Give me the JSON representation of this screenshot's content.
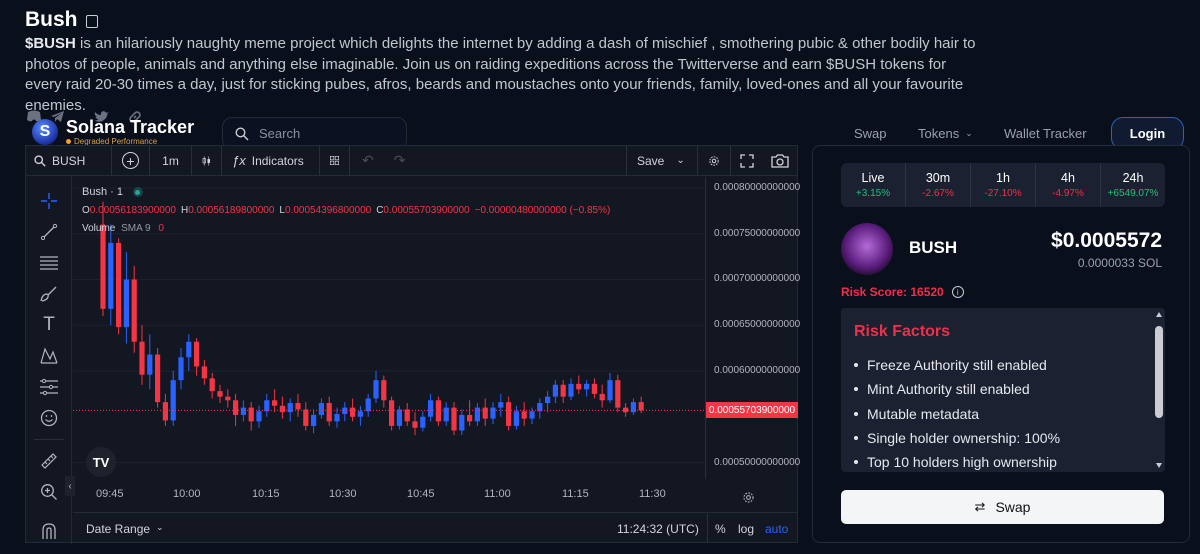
{
  "project": {
    "title": "Bush",
    "desc_ticker": "$BUSH",
    "description": " is an hilariously naughty meme project which delights the internet by adding a dash of mischief , smothering pubic & other bodily hair to photos of people, animals and anything else imaginable. Join us on raiding expeditions across the Twitterverse and earn $BUSH tokens for every raid 20-30 times a day, just for sticking pubes, afros, beards and moustaches onto your friends, family, loved-ones and all your favourite enemies."
  },
  "header": {
    "brand": "Solana Tracker",
    "brand_status": "Degraded Performance",
    "search_placeholder": "Search",
    "nav": [
      "Swap",
      "Tokens",
      "Wallet Tracker"
    ],
    "login": "Login"
  },
  "chart_toolbar": {
    "symbol": "BUSH",
    "interval": "1m",
    "indicators": "Indicators",
    "save": "Save"
  },
  "chart_legend": {
    "symbol_line": "Bush · 1",
    "o_label": "O",
    "o": "0.00056183900000",
    "h_label": "H",
    "h": "0.00056189800000",
    "l_label": "L",
    "l": "0.00054396800000",
    "c_label": "C",
    "c": "0.00055703900000",
    "change": "−0.00000480000000 (−0.85%)",
    "volume_label": "Volume",
    "volume_sma": "SMA 9",
    "volume_value": "0",
    "last_price_tag": "0.00055703900000"
  },
  "chart_bottom": {
    "date_range": "Date Range",
    "clock": "11:24:32 (UTC)",
    "percent": "%",
    "log": "log",
    "auto": "auto"
  },
  "chart_data": {
    "type": "candlestick",
    "title": "Bush · 1",
    "x_ticks": [
      "09:45",
      "10:00",
      "10:15",
      "10:30",
      "10:45",
      "11:00",
      "11:15",
      "11:30"
    ],
    "y_ticks": [
      "0.00080000000000",
      "0.00075000000000",
      "0.00070000000000",
      "0.00065000000000",
      "0.00060000000000",
      "0.00050000000000"
    ],
    "ylim": [
      0.000482,
      0.000812
    ],
    "up_color": "#2962ff",
    "down_color": "#f23645",
    "candles": [
      [
        0.00076,
        0.000785,
        0.00066,
        0.000668
      ],
      [
        0.000668,
        0.00076,
        0.00065,
        0.00074
      ],
      [
        0.00074,
        0.000745,
        0.00064,
        0.000648
      ],
      [
        0.000648,
        0.00073,
        0.00063,
        0.0007
      ],
      [
        0.0007,
        0.000715,
        0.00062,
        0.000632
      ],
      [
        0.000632,
        0.00065,
        0.000585,
        0.000596
      ],
      [
        0.000596,
        0.00064,
        0.00058,
        0.000618
      ],
      [
        0.000618,
        0.000625,
        0.00056,
        0.000566
      ],
      [
        0.000566,
        0.000575,
        0.00054,
        0.000546
      ],
      [
        0.000546,
        0.0006,
        0.00054,
        0.00059
      ],
      [
        0.00059,
        0.000625,
        0.00058,
        0.000615
      ],
      [
        0.000615,
        0.00064,
        0.0006,
        0.000632
      ],
      [
        0.000632,
        0.000636,
        0.000595,
        0.000605
      ],
      [
        0.000605,
        0.000612,
        0.000585,
        0.000592
      ],
      [
        0.000592,
        0.000598,
        0.00057,
        0.000578
      ],
      [
        0.000578,
        0.000585,
        0.000565,
        0.000572
      ],
      [
        0.000572,
        0.00058,
        0.00056,
        0.000568
      ],
      [
        0.000568,
        0.000575,
        0.00054,
        0.000552
      ],
      [
        0.000552,
        0.000568,
        0.000545,
        0.00056
      ],
      [
        0.00056,
        0.000566,
        0.000535,
        0.000545
      ],
      [
        0.000545,
        0.000562,
        0.000538,
        0.000556
      ],
      [
        0.000556,
        0.000575,
        0.00055,
        0.000568
      ],
      [
        0.000568,
        0.00058,
        0.000555,
        0.000562
      ],
      [
        0.000562,
        0.000572,
        0.000548,
        0.000555
      ],
      [
        0.000555,
        0.00057,
        0.000545,
        0.000565
      ],
      [
        0.000565,
        0.000575,
        0.00055,
        0.000558
      ],
      [
        0.000558,
        0.000566,
        0.000535,
        0.00054
      ],
      [
        0.00054,
        0.000558,
        0.000532,
        0.000552
      ],
      [
        0.000552,
        0.00057,
        0.000548,
        0.000565
      ],
      [
        0.000565,
        0.000572,
        0.00054,
        0.000545
      ],
      [
        0.000545,
        0.00056,
        0.000538,
        0.000553
      ],
      [
        0.000553,
        0.000566,
        0.000545,
        0.00056
      ],
      [
        0.00056,
        0.00057,
        0.000545,
        0.00055
      ],
      [
        0.00055,
        0.000562,
        0.00054,
        0.000556
      ],
      [
        0.000556,
        0.000575,
        0.00055,
        0.00057
      ],
      [
        0.00057,
        0.0006,
        0.000565,
        0.00059
      ],
      [
        0.00059,
        0.000595,
        0.00056,
        0.000568
      ],
      [
        0.000568,
        0.000572,
        0.000535,
        0.00054
      ],
      [
        0.00054,
        0.000562,
        0.000536,
        0.000558
      ],
      [
        0.000558,
        0.000565,
        0.00054,
        0.000545
      ],
      [
        0.000545,
        0.000555,
        0.00053,
        0.000538
      ],
      [
        0.000538,
        0.000556,
        0.000534,
        0.00055
      ],
      [
        0.00055,
        0.000575,
        0.000545,
        0.000568
      ],
      [
        0.000568,
        0.000572,
        0.00054,
        0.000545
      ],
      [
        0.000545,
        0.000566,
        0.00054,
        0.00056
      ],
      [
        0.00056,
        0.000566,
        0.00053,
        0.000535
      ],
      [
        0.000535,
        0.000558,
        0.00053,
        0.000552
      ],
      [
        0.000552,
        0.000568,
        0.00054,
        0.000545
      ],
      [
        0.000545,
        0.000565,
        0.00054,
        0.00056
      ],
      [
        0.00056,
        0.00057,
        0.00054,
        0.000548
      ],
      [
        0.000548,
        0.000566,
        0.000542,
        0.00056
      ],
      [
        0.00056,
        0.000575,
        0.00055,
        0.000566
      ],
      [
        0.000566,
        0.000572,
        0.000535,
        0.00054
      ],
      [
        0.00054,
        0.000562,
        0.000536,
        0.000556
      ],
      [
        0.000556,
        0.000566,
        0.00054,
        0.000548
      ],
      [
        0.000548,
        0.00056,
        0.000542,
        0.000556
      ],
      [
        0.000556,
        0.00057,
        0.000548,
        0.000565
      ],
      [
        0.000565,
        0.000578,
        0.000555,
        0.000572
      ],
      [
        0.000572,
        0.00059,
        0.000565,
        0.000585
      ],
      [
        0.000585,
        0.00059,
        0.000565,
        0.000572
      ],
      [
        0.000572,
        0.000592,
        0.000568,
        0.000586
      ],
      [
        0.000586,
        0.000595,
        0.000575,
        0.00058
      ],
      [
        0.00058,
        0.00059,
        0.000572,
        0.000586
      ],
      [
        0.000586,
        0.000592,
        0.00057,
        0.000575
      ],
      [
        0.000575,
        0.000585,
        0.00056,
        0.000568
      ],
      [
        0.000568,
        0.000598,
        0.000565,
        0.00059
      ],
      [
        0.00059,
        0.000596,
        0.000555,
        0.00056
      ],
      [
        0.00056,
        0.000565,
        0.00055,
        0.000555
      ],
      [
        0.000555,
        0.00057,
        0.000552,
        0.000566
      ],
      [
        0.000566,
        0.000572,
        0.000554,
        0.000557
      ]
    ]
  },
  "token": {
    "timeframes": [
      {
        "label": "Live",
        "value": "+3.15%",
        "color": "#1fc07a"
      },
      {
        "label": "30m",
        "value": "-2.67%",
        "color": "#f0304a"
      },
      {
        "label": "1h",
        "value": "-27.10%",
        "color": "#f0304a"
      },
      {
        "label": "4h",
        "value": "-4.97%",
        "color": "#f0304a"
      },
      {
        "label": "24h",
        "value": "+6549.07%",
        "color": "#1fc07a"
      }
    ],
    "name": "BUSH",
    "price_usd": "$0.0005572",
    "price_sol": "0.0000033 SOL",
    "risk_score": "Risk Score: 16520",
    "risk_title": "Risk Factors",
    "risk_factors": [
      "Freeze Authority still enabled",
      "Mint Authority still enabled",
      "Mutable metadata",
      "Single holder ownership: 100%",
      "Top 10 holders high ownership"
    ],
    "swap_label": "Swap"
  }
}
